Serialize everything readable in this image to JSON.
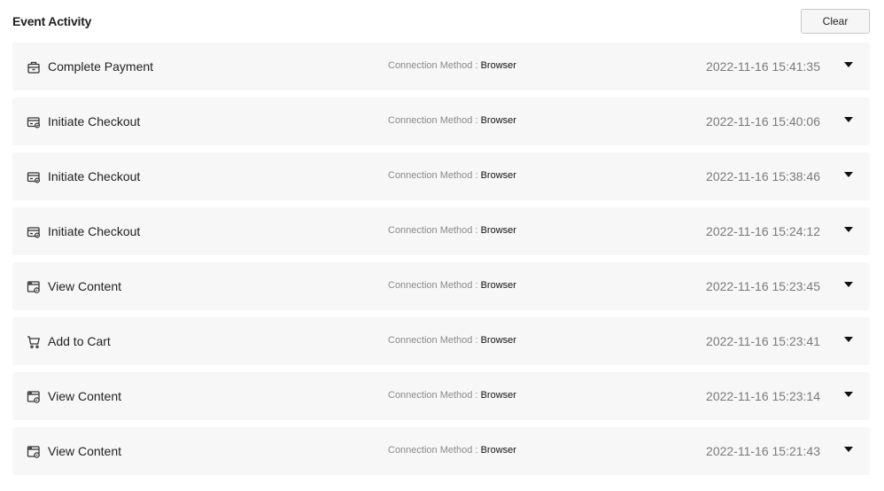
{
  "header": {
    "title": "Event Activity",
    "clear_label": "Clear"
  },
  "events": [
    {
      "icon": "payment-icon",
      "name": "Complete Payment",
      "connection_label": "Connection Method :",
      "connection_value": "Browser",
      "timestamp": "2022-11-16 15:41:35"
    },
    {
      "icon": "checkout-icon",
      "name": "Initiate Checkout",
      "connection_label": "Connection Method :",
      "connection_value": "Browser",
      "timestamp": "2022-11-16 15:40:06"
    },
    {
      "icon": "checkout-icon",
      "name": "Initiate Checkout",
      "connection_label": "Connection Method :",
      "connection_value": "Browser",
      "timestamp": "2022-11-16 15:38:46"
    },
    {
      "icon": "checkout-icon",
      "name": "Initiate Checkout",
      "connection_label": "Connection Method :",
      "connection_value": "Browser",
      "timestamp": "2022-11-16 15:24:12"
    },
    {
      "icon": "view-content-icon",
      "name": "View Content",
      "connection_label": "Connection Method :",
      "connection_value": "Browser",
      "timestamp": "2022-11-16 15:23:45"
    },
    {
      "icon": "cart-icon",
      "name": "Add to Cart",
      "connection_label": "Connection Method :",
      "connection_value": "Browser",
      "timestamp": "2022-11-16 15:23:41"
    },
    {
      "icon": "view-content-icon",
      "name": "View Content",
      "connection_label": "Connection Method :",
      "connection_value": "Browser",
      "timestamp": "2022-11-16 15:23:14"
    },
    {
      "icon": "view-content-icon",
      "name": "View Content",
      "connection_label": "Connection Method :",
      "connection_value": "Browser",
      "timestamp": "2022-11-16 15:21:43"
    }
  ]
}
